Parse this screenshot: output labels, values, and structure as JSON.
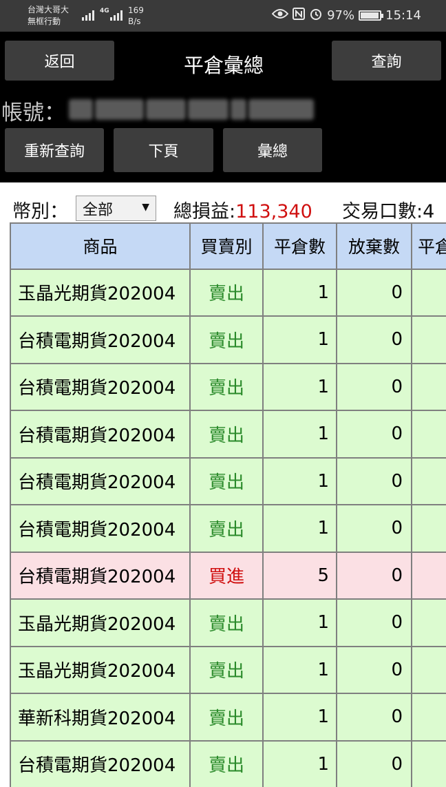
{
  "status_bar": {
    "carrier_line1": "台灣大哥大",
    "carrier_line2": "無框行動",
    "network": "4G",
    "speed_value": "169",
    "speed_unit": "B/s",
    "battery": "97%",
    "battery_level": 0.97,
    "time": "15:14"
  },
  "header": {
    "back_label": "返回",
    "title": "平倉彙總",
    "query_label": "查詢",
    "account_label": "帳號：",
    "requery_label": "重新查詢",
    "next_page_label": "下頁",
    "summary_label": "彙總"
  },
  "summary": {
    "currency_label": "幣別：",
    "currency_value": "全部",
    "total_pnl_label": "總損益:",
    "total_pnl_value": "113,340",
    "trades_label": "交易口數:4"
  },
  "table": {
    "columns": [
      "商品",
      "買賣別",
      "平倉數",
      "放棄數",
      "平倉"
    ],
    "rows": [
      {
        "product": "玉晶光期貨202004",
        "side": "賣出",
        "closed": "1",
        "abandoned": "0",
        "type": "sell"
      },
      {
        "product": "台積電期貨202004",
        "side": "賣出",
        "closed": "1",
        "abandoned": "0",
        "type": "sell"
      },
      {
        "product": "台積電期貨202004",
        "side": "賣出",
        "closed": "1",
        "abandoned": "0",
        "type": "sell"
      },
      {
        "product": "台積電期貨202004",
        "side": "賣出",
        "closed": "1",
        "abandoned": "0",
        "type": "sell"
      },
      {
        "product": "台積電期貨202004",
        "side": "賣出",
        "closed": "1",
        "abandoned": "0",
        "type": "sell"
      },
      {
        "product": "台積電期貨202004",
        "side": "賣出",
        "closed": "1",
        "abandoned": "0",
        "type": "sell"
      },
      {
        "product": "台積電期貨202004",
        "side": "買進",
        "closed": "5",
        "abandoned": "0",
        "type": "buy"
      },
      {
        "product": "玉晶光期貨202004",
        "side": "賣出",
        "closed": "1",
        "abandoned": "0",
        "type": "sell"
      },
      {
        "product": "玉晶光期貨202004",
        "side": "賣出",
        "closed": "1",
        "abandoned": "0",
        "type": "sell"
      },
      {
        "product": "華新科期貨202004",
        "side": "賣出",
        "closed": "1",
        "abandoned": "0",
        "type": "sell"
      },
      {
        "product": "台積電期貨202004",
        "side": "賣出",
        "closed": "1",
        "abandoned": "0",
        "type": "sell"
      }
    ]
  },
  "colors": {
    "header_bg": "#000000",
    "button_bg": "#3d3d3d",
    "column_header_bg": "#c5d9f5",
    "sell_row_bg": "#dcfbd0",
    "buy_row_bg": "#fbe0e4",
    "sell_text": "#2a8a2a",
    "buy_text": "#d01010",
    "pnl_text": "#d01010"
  }
}
